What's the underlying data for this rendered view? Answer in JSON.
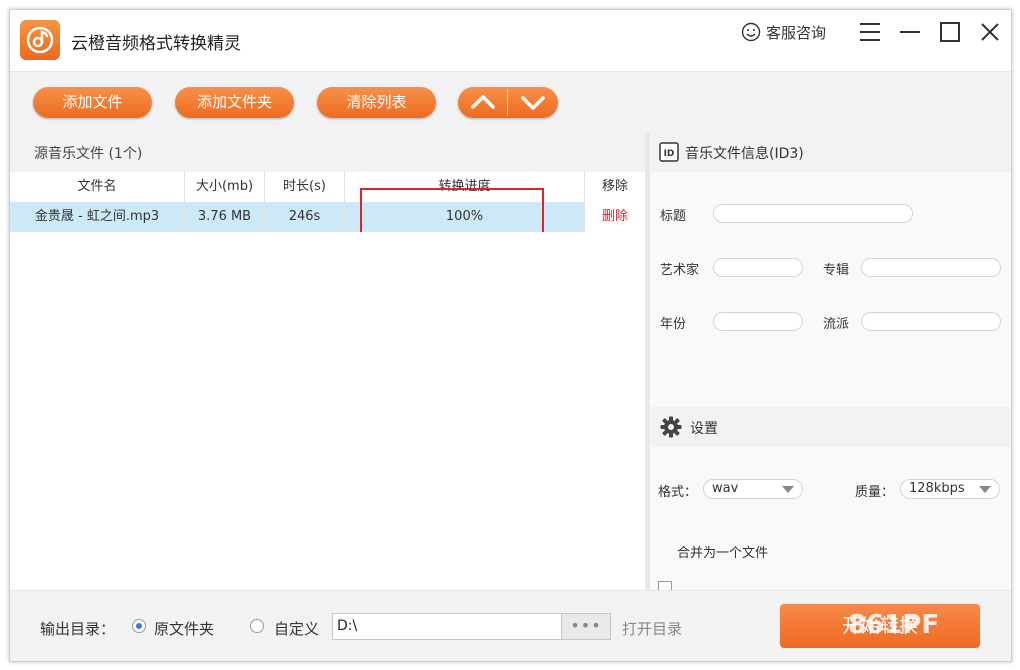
{
  "app": {
    "title": "云橙音频格式转换精灵",
    "support": "客服咨询"
  },
  "toolbar": {
    "add_file": "添加文件",
    "add_folder": "添加文件夹",
    "clear_list": "清除列表"
  },
  "source": {
    "header": "源音乐文件 (1个)"
  },
  "table": {
    "columns": [
      "文件名",
      "大小(mb)",
      "时长(s)",
      "转换进度",
      "移除"
    ],
    "rows": [
      {
        "name": "金贵晟 - 虹之间.mp3",
        "size": "3.76 MB",
        "duration": "246s",
        "progress": "100%",
        "remove": "删除"
      }
    ]
  },
  "id3": {
    "badge": "ID",
    "header": "音乐文件信息(ID3)",
    "title_label": "标题",
    "artist_label": "艺术家",
    "album_label": "专辑",
    "year_label": "年份",
    "genre_label": "流派"
  },
  "settings": {
    "header": "设置",
    "format_label": "格式：",
    "format_value": "wav",
    "quality_label": "质量：",
    "quality_value": "128kbps",
    "merge_label": "合并为一个文件"
  },
  "output": {
    "label": "输出目录：",
    "option_original": "原文件夹",
    "option_custom": "自定义",
    "path": "D:\\",
    "browse": "•••",
    "open_dir": "打开目录"
  },
  "start_button": "开始转换",
  "watermark": "861PF",
  "colors": {
    "accent": "#ee6b1f",
    "selected_row": "#cde8f7",
    "highlight_box": "#d9252b",
    "remove_text": "#d9252b"
  }
}
